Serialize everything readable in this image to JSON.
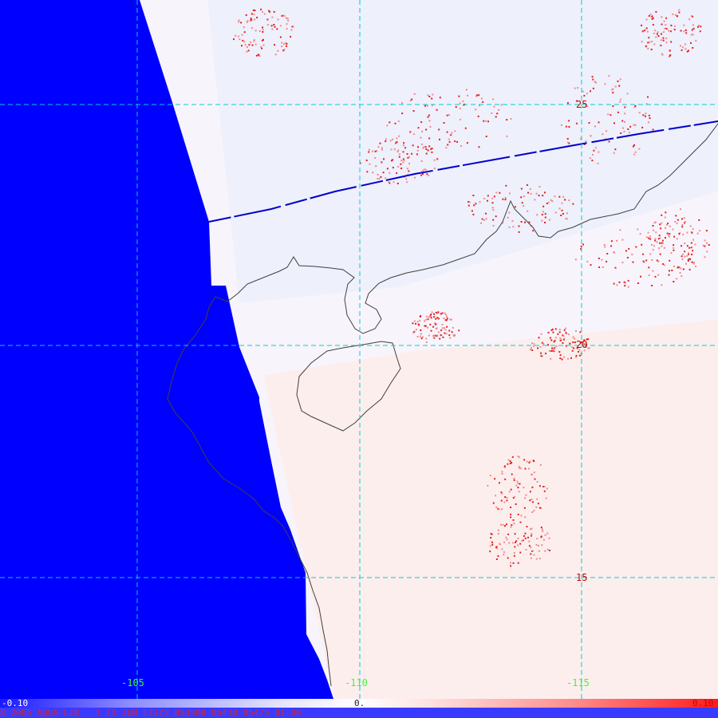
{
  "map": {
    "longitude_labels": [
      "-105",
      "-110",
      "-115"
    ],
    "latitude_labels": [
      "25",
      "20",
      "15"
    ],
    "colorbar": {
      "min_label": "-0.10",
      "mid_label": "0.",
      "max_label": "0.10",
      "low_color": "#1a1aff",
      "high_color": "#ff1a1a"
    },
    "info_bar": "8 2005 AQUA-L1B   1 23 JUN 13173 053500 05430 05475 01.00",
    "colors": {
      "ocean_mask": "#0000ff",
      "grid": "#00d0d0",
      "coastline": "#404040",
      "track": "#0000cc"
    }
  }
}
